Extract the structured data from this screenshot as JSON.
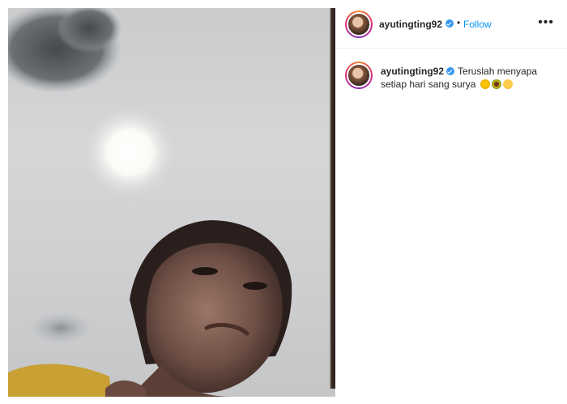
{
  "post": {
    "username": "ayutingting92",
    "follow_label": "Follow",
    "dot": "•",
    "more_label": "•••",
    "caption_text": "Teruslah menyapa setiap hari sang surya",
    "emojis": [
      "sun-emoji",
      "sunflower-emoji",
      "smiling-face-emoji"
    ]
  },
  "colors": {
    "link_blue": "#0095f6",
    "verified_blue": "#3897f0",
    "text": "#262626"
  }
}
